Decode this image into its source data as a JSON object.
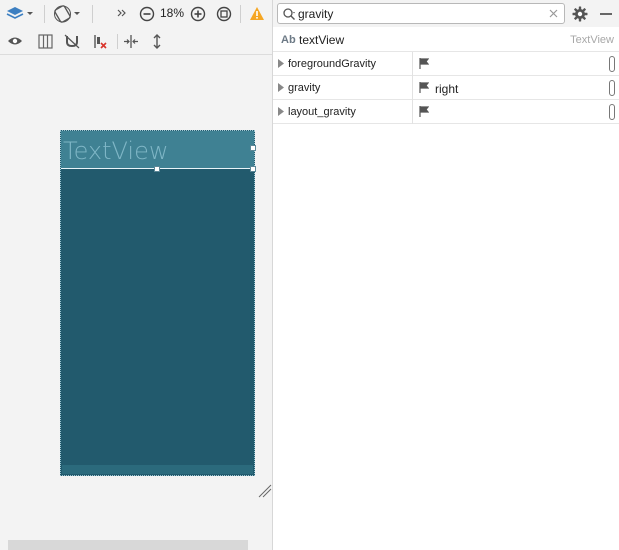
{
  "toolbar": {
    "zoom_label": "18%"
  },
  "design": {
    "textview_label": "TextView"
  },
  "panel": {
    "search": {
      "value": "gravity",
      "placeholder": ""
    },
    "component": {
      "icon_text": "Ab",
      "id": "textView",
      "type": "TextView"
    },
    "attributes": [
      {
        "name": "foregroundGravity",
        "value": ""
      },
      {
        "name": "gravity",
        "value": "right"
      },
      {
        "name": "layout_gravity",
        "value": ""
      }
    ]
  },
  "colors": {
    "device_bg": "#225a6d",
    "selected_view_bg": "#3f8193",
    "selected_view_text": "#7fb6c6",
    "warning": "#f5a623"
  }
}
